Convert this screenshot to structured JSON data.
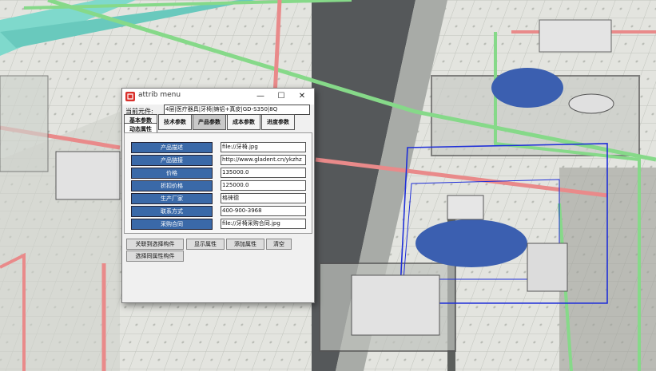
{
  "window": {
    "title": "attrib menu",
    "controls": {
      "minimize": "—",
      "maximize": "☐",
      "close": "✕"
    }
  },
  "element": {
    "label": "当前元件:",
    "value": "4层|医疗器具|牙椅|铸铝+真皮|GD-S350|8Q"
  },
  "tabs": [
    "基本参数",
    "动态属性",
    "技术参数",
    "产品参数",
    "成本参数",
    "进度参数"
  ],
  "active_tab": "产品参数",
  "rows": [
    {
      "label": "产品描述",
      "value": "file://牙椅.jpg"
    },
    {
      "label": "产品链接",
      "value": "http://www.gladent.cn/ykzhz"
    },
    {
      "label": "价格",
      "value": "135000.0"
    },
    {
      "label": "折扣价格",
      "value": "125000.0"
    },
    {
      "label": "生产厂家",
      "value": "格徕德"
    },
    {
      "label": "联系方式",
      "value": "400-900-3968"
    },
    {
      "label": "采购合同",
      "value": "file://牙椅采购合同.jpg"
    }
  ],
  "buttons": {
    "link": "关联到选择构件",
    "show": "显示属性",
    "add": "添加属性",
    "clear": "清空",
    "select_same": "选择同属性构件"
  },
  "colors": {
    "label_bg": "#3a69a8",
    "wire_green": "#7fd67f",
    "wire_pink": "#e98a8a",
    "teal": "#6fd6c8",
    "chair_blue": "#3b5fb0"
  }
}
